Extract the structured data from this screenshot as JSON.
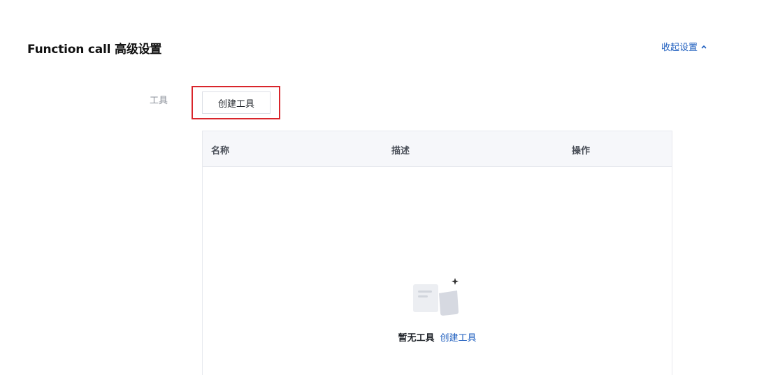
{
  "header": {
    "title": "Function call 高级设置",
    "collapse_label": "收起设置",
    "collapse_icon": "chevron-up-icon"
  },
  "form": {
    "tools_label": "工具",
    "create_button_label": "创建工具"
  },
  "table": {
    "columns": [
      "名称",
      "描述",
      "操作"
    ],
    "rows": []
  },
  "empty_state": {
    "icon": "empty-documents-icon",
    "text": "暂无工具",
    "link_label": "创建工具"
  },
  "colors": {
    "accent": "#1f5fbf",
    "highlight_border": "#d9252b",
    "table_header_bg": "#f6f7fa"
  }
}
